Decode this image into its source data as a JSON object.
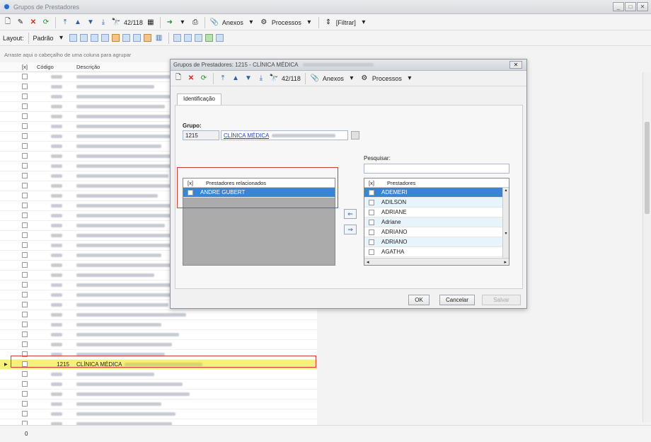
{
  "window": {
    "title": "Grupos de Prestadores"
  },
  "toolbar": {
    "record_pos": "42/118",
    "anexos": "Anexos",
    "processos": "Processos",
    "filtrar": "[Filtrar]"
  },
  "layout_bar": {
    "layout_label": "Layout:",
    "padrao": "Padrão"
  },
  "group_hint": "Arraste aqui o cabeçalho de uma coluna para agrupar",
  "grid": {
    "headers": {
      "chk": "[x]",
      "code": "Código",
      "desc": "Descrição"
    },
    "selected_row": {
      "code": "1215",
      "desc": "CLÍNICA MÉDICA"
    }
  },
  "status": {
    "count": "0"
  },
  "dialog": {
    "title": "Grupos de Prestadores: 1215 - CLÍNICA MÉDICA",
    "record_pos": "42/118",
    "anexos": "Anexos",
    "processos": "Processos",
    "tab": "Identificação",
    "group_label": "Grupo:",
    "group_code": "1215",
    "group_name": "CLÍNICA MÉDICA",
    "search_label": "Pesquisar:",
    "left_list": {
      "headers": {
        "chk": "[x]",
        "name": "Prestadores relacionados"
      },
      "rows": [
        "ANDRE GUBERT"
      ]
    },
    "right_list": {
      "headers": {
        "chk": "[x]",
        "name": "Prestadores"
      },
      "rows": [
        "ADEMERI",
        "ADILSON",
        "ADRIANE",
        "Adriane",
        "ADRIANO",
        "ADRIANO",
        "AGATHA"
      ]
    },
    "buttons": {
      "ok": "OK",
      "cancel": "Cancelar",
      "save": "Salvar"
    }
  }
}
